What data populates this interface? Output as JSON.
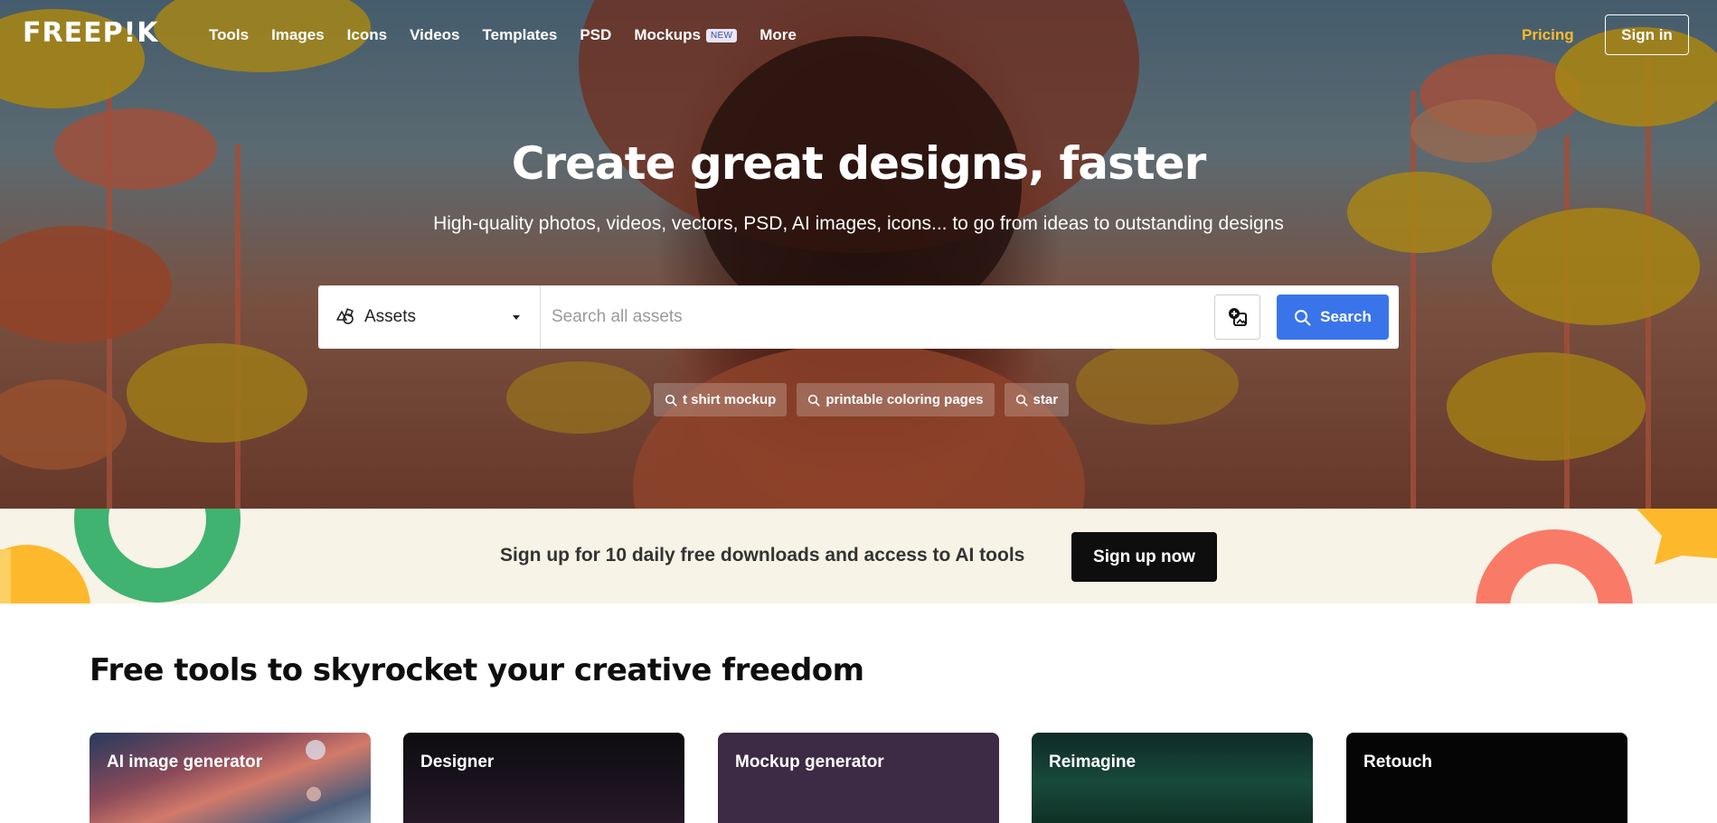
{
  "brand": {
    "logo_text": "FREEP!K"
  },
  "nav": {
    "links": [
      {
        "label": "Tools"
      },
      {
        "label": "Images"
      },
      {
        "label": "Icons"
      },
      {
        "label": "Videos"
      },
      {
        "label": "Templates"
      },
      {
        "label": "PSD"
      },
      {
        "label": "Mockups",
        "badge": "NEW"
      },
      {
        "label": "More"
      }
    ],
    "pricing": "Pricing",
    "signin": "Sign in"
  },
  "hero": {
    "title": "Create great designs, faster",
    "subtitle": "High-quality photos, videos, vectors, PSD, AI images, icons... to go from ideas to outstanding designs"
  },
  "search": {
    "category": "Assets",
    "placeholder": "Search all assets",
    "button": "Search",
    "suggestions": [
      "t shirt mockup",
      "printable coloring pages",
      "star"
    ]
  },
  "banner": {
    "text": "Sign up for 10 daily free downloads and access to AI tools",
    "button": "Sign up now"
  },
  "tools": {
    "title": "Free tools to skyrocket your creative freedom",
    "cards": [
      {
        "label": "AI image generator"
      },
      {
        "label": "Designer"
      },
      {
        "label": "Mockup generator"
      },
      {
        "label": "Reimagine"
      },
      {
        "label": "Retouch"
      }
    ]
  },
  "colors": {
    "accent_blue": "#3a74ea",
    "pricing_yellow": "#fdb92b",
    "banner_bg": "#f7f3e6",
    "dark_button": "#0e0e0e"
  },
  "icons": [
    "assets-shapes-icon",
    "caret-down-icon",
    "image-search-icon",
    "search-icon"
  ]
}
